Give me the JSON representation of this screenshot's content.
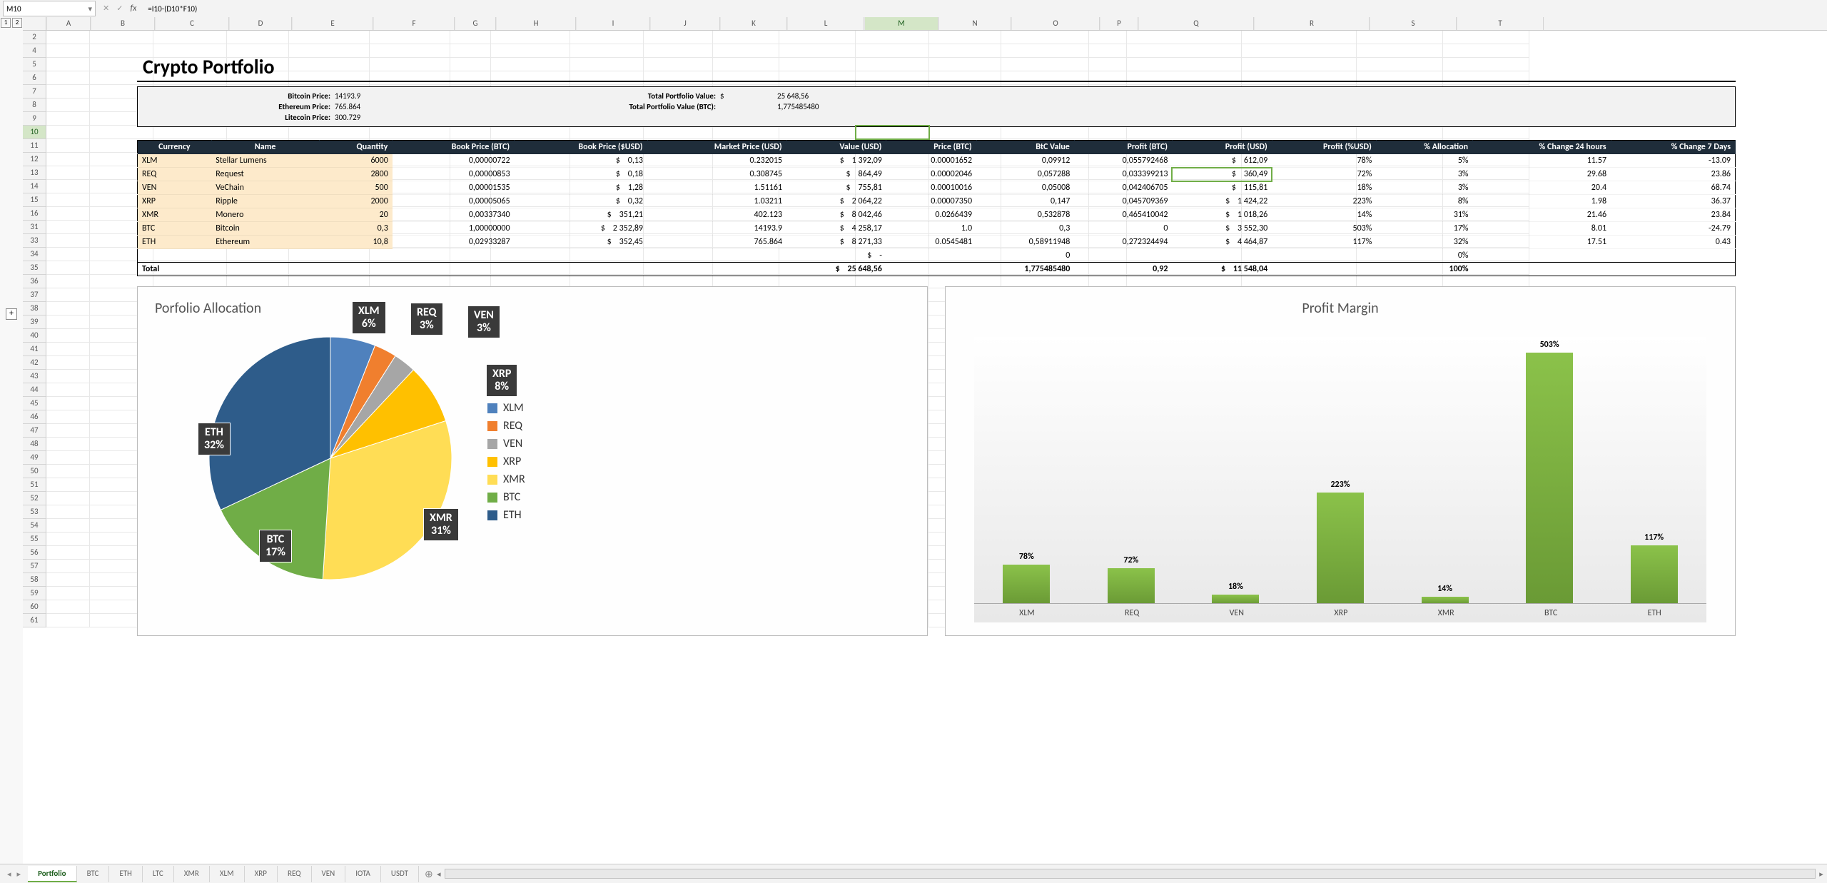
{
  "formula_bar": {
    "namebox": "M10",
    "formula": "=I10-(D10*F10)"
  },
  "outline_levels": [
    "1",
    "2"
  ],
  "columns": [
    "",
    "A",
    "B",
    "C",
    "D",
    "E",
    "F",
    "G",
    "H",
    "I",
    "J",
    "K",
    "L",
    "M",
    "N",
    "O",
    "P",
    "Q",
    "R",
    "S",
    "T"
  ],
  "selected_col": "M",
  "selected_row": "10",
  "visible_rows_a": [
    "2",
    "4",
    "5",
    "6",
    "7",
    "8",
    "9",
    "10",
    "11",
    "12",
    "13",
    "14",
    "15",
    "16",
    "31"
  ],
  "visible_rows_b": [
    "33",
    "34",
    "35",
    "36",
    "37",
    "38",
    "39",
    "40",
    "41",
    "42",
    "43",
    "44",
    "45",
    "46",
    "47",
    "48",
    "49",
    "50",
    "51",
    "52",
    "53",
    "54",
    "55",
    "56",
    "57",
    "58",
    "59",
    "60",
    "61"
  ],
  "page": {
    "title": "Crypto Portfolio",
    "info": {
      "btc_lbl": "Bitcoin Price:",
      "btc": "14193.9",
      "eth_lbl": "Ethereum Price:",
      "eth": "765.864",
      "ltc_lbl": "Litecoin Price:",
      "ltc": "300.729",
      "tpv_lbl": "Total Portfolio Value:",
      "tpv_cur": "$",
      "tpv": "25 648,56",
      "tpvb_lbl": "Total Portfolio Value (BTC):",
      "tpvb": "1,775485480"
    }
  },
  "table": {
    "headers": [
      "Currency",
      "Name",
      "Quantity",
      "Book Price (BTC)",
      "Book Price ($USD)",
      "Market Price (USD)",
      "Value (USD)",
      "Price (BTC)",
      "BtC Value",
      "Profit (BTC)",
      "Profit (USD)",
      "Profit (%USD)",
      "% Allocation",
      "% Change 24 hours",
      "% Change 7 Days"
    ],
    "rows": [
      {
        "cur": "XLM",
        "name": "Stellar Lumens",
        "qty": "6000",
        "bpb": "0,00000722",
        "bpu": "0,13",
        "mp": "0.232015",
        "val": "1 392,09",
        "pb": "0.00001652",
        "bv": "0,09912",
        "prb": "0,055792468",
        "pru": "612,09",
        "prp": "78%",
        "al": "5%",
        "c24": "11.57",
        "c7": "-13.09"
      },
      {
        "cur": "REQ",
        "name": "Request",
        "qty": "2800",
        "bpb": "0,00000853",
        "bpu": "0,18",
        "mp": "0.308745",
        "val": "864,49",
        "pb": "0.00002046",
        "bv": "0,057288",
        "prb": "0,033399213",
        "pru": "360,49",
        "prp": "72%",
        "al": "3%",
        "c24": "29.68",
        "c7": "23.86",
        "hl": true
      },
      {
        "cur": "VEN",
        "name": "VeChain",
        "qty": "500",
        "bpb": "0,00001535",
        "bpu": "1,28",
        "mp": "1.51161",
        "val": "755,81",
        "pb": "0.00010016",
        "bv": "0,05008",
        "prb": "0,042406705",
        "pru": "115,81",
        "prp": "18%",
        "al": "3%",
        "c24": "20.4",
        "c7": "68.74"
      },
      {
        "cur": "XRP",
        "name": "Ripple",
        "qty": "2000",
        "bpb": "0,00005065",
        "bpu": "0,32",
        "mp": "1.03211",
        "val": "2 064,22",
        "pb": "0.00007350",
        "bv": "0,147",
        "prb": "0,045709369",
        "pru": "1 424,22",
        "prp": "223%",
        "al": "8%",
        "c24": "1.98",
        "c7": "36.37"
      },
      {
        "cur": "XMR",
        "name": "Monero",
        "qty": "20",
        "bpb": "0,00337340",
        "bpu": "351,21",
        "mp": "402.123",
        "val": "8 042,46",
        "pb": "0.0266439",
        "bv": "0,532878",
        "prb": "0,465410042",
        "pru": "1 018,26",
        "prp": "14%",
        "al": "31%",
        "c24": "21.46",
        "c7": "23.84"
      },
      {
        "cur": "BTC",
        "name": "Bitcoin",
        "qty": "0,3",
        "bpb": "1,00000000",
        "bpu": "2 352,89",
        "mp": "14193.9",
        "val": "4 258,17",
        "pb": "1.0",
        "bv": "0,3",
        "prb": "0",
        "pru": "3 552,30",
        "prp": "503%",
        "al": "17%",
        "c24": "8.01",
        "c7": "-24.79"
      },
      {
        "cur": "ETH",
        "name": "Ethereum",
        "qty": "10,8",
        "bpb": "0,02933287",
        "bpu": "352,45",
        "mp": "765.864",
        "val": "8 271,33",
        "pb": "0.0545481",
        "bv": "0,58911948",
        "prb": "0,272324494",
        "pru": "4 464,87",
        "prp": "117%",
        "al": "32%",
        "c24": "17.51",
        "c7": "0.43"
      }
    ],
    "blank": {
      "val": "-",
      "bv": "0",
      "al": "0%"
    },
    "total": {
      "label": "Total",
      "val": "25 648,56",
      "bv": "1,775485480",
      "prb": "0,92",
      "pru": "11 548,04",
      "al": "100%"
    }
  },
  "chart_data": [
    {
      "type": "pie",
      "title": "Porfolio Allocation",
      "categories": [
        "XLM",
        "REQ",
        "VEN",
        "XRP",
        "XMR",
        "BTC",
        "ETH"
      ],
      "values": [
        6,
        3,
        3,
        8,
        31,
        17,
        32
      ],
      "colors": [
        "#4f81bd",
        "#f07f2e",
        "#a6a6a6",
        "#ffc000",
        "#ffdd55",
        "#70ad47",
        "#2e5c8a"
      ],
      "legend_position": "right"
    },
    {
      "type": "bar",
      "title": "Profit Margin",
      "categories": [
        "XLM",
        "REQ",
        "VEN",
        "XRP",
        "XMR",
        "BTC",
        "ETH"
      ],
      "values": [
        78,
        72,
        18,
        223,
        14,
        503,
        117
      ],
      "ylim": [
        0,
        520
      ],
      "bar_color": "#70ad47"
    }
  ],
  "sheet_tabs": [
    "Portfolio",
    "BTC",
    "ETH",
    "LTC",
    "XMR",
    "XLM",
    "XRP",
    "REQ",
    "VEN",
    "IOTA",
    "USDT"
  ],
  "active_tab": "Portfolio"
}
